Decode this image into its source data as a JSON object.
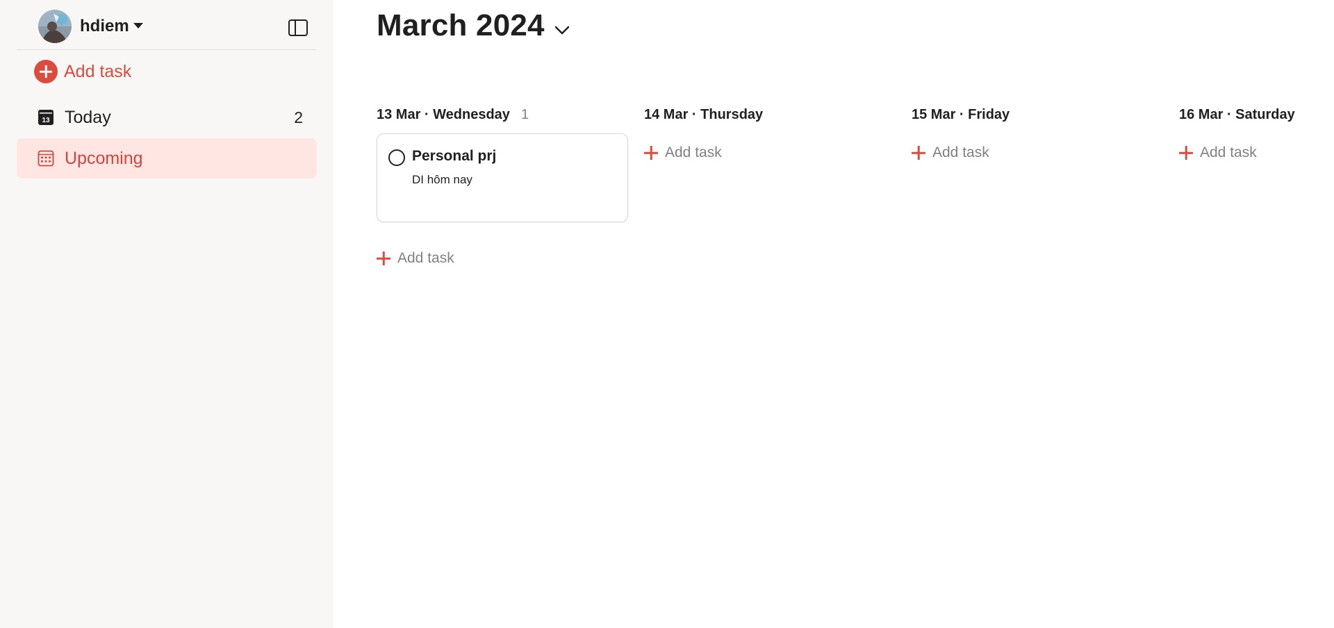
{
  "sidebar": {
    "username": "hdiem",
    "add_task_label": "Add task",
    "items": [
      {
        "label": "Today",
        "count": "2",
        "icon": "calendar-today-icon",
        "icon_day": "13"
      },
      {
        "label": "Upcoming",
        "count": "",
        "icon": "calendar-grid-icon",
        "active": true
      }
    ]
  },
  "main": {
    "month_title": "March 2024",
    "days": [
      {
        "header": "13 Mar · Wednesday",
        "count": "1",
        "tasks": [
          {
            "title": "Personal prj",
            "description": "DI hôm nay"
          }
        ],
        "add_task_label": "Add task"
      },
      {
        "header": "14 Mar · Thursday",
        "count": "",
        "tasks": [],
        "add_task_label": "Add task"
      },
      {
        "header": "15 Mar · Friday",
        "count": "",
        "tasks": [],
        "add_task_label": "Add task"
      },
      {
        "header": "16 Mar · Saturday",
        "count": "",
        "tasks": [],
        "add_task_label": "Add task"
      }
    ]
  },
  "colors": {
    "accent": "#dc4c3e",
    "active_bg": "#ffe6e2",
    "sidebar_bg": "#f9f7f5",
    "muted_text": "#808080"
  }
}
